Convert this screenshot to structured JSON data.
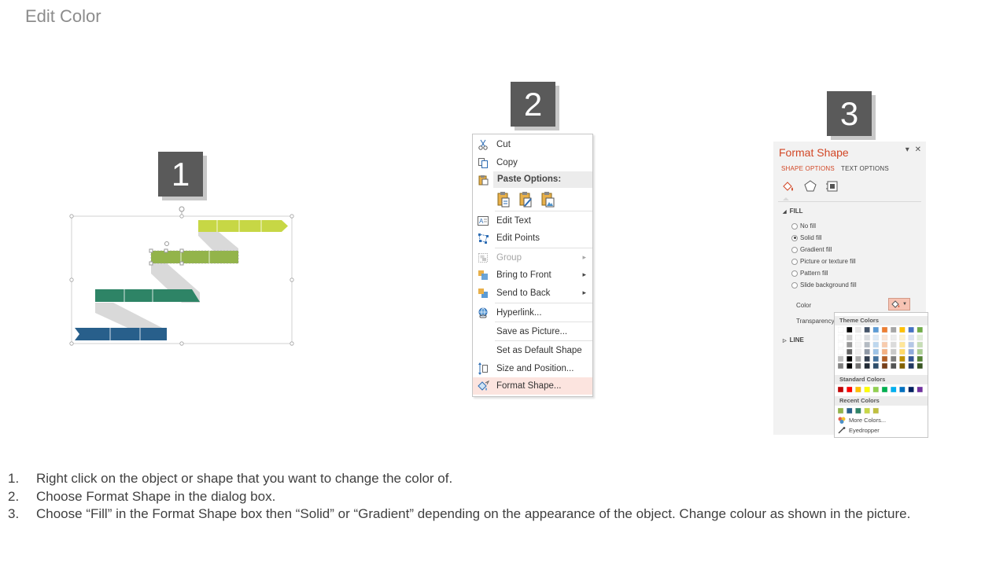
{
  "slide": {
    "title": "Edit Color"
  },
  "steps": {
    "badge1": "1",
    "badge2": "2",
    "badge3": "3"
  },
  "colors": {
    "title_gray": "#8c8c8c",
    "badge_bg": "#5a5a5a",
    "accent_orange": "#d24726",
    "stair_lime": "#c7d745",
    "stair_green": "#93b44a",
    "stair_teal": "#2e8466",
    "stair_blue": "#285f8b"
  },
  "context_menu": {
    "items": [
      {
        "label": "Cut",
        "icon": "scissors-icon"
      },
      {
        "label": "Copy",
        "icon": "copy-icon"
      },
      {
        "label": "Paste Options:",
        "icon": "clipboard-icon"
      },
      {
        "label": "Edit Text",
        "icon": "edit-text-icon"
      },
      {
        "label": "Edit Points",
        "icon": "edit-points-icon"
      },
      {
        "label": "Group",
        "icon": "group-icon",
        "disabled": true
      },
      {
        "label": "Bring to Front",
        "icon": "bring-to-front-icon"
      },
      {
        "label": "Send to Back",
        "icon": "send-to-back-icon"
      },
      {
        "label": "Hyperlink...",
        "icon": "hyperlink-icon"
      },
      {
        "label": "Save as Picture...",
        "icon": ""
      },
      {
        "label": "Set as Default Shape",
        "icon": ""
      },
      {
        "label": "Size and Position...",
        "icon": "size-position-icon"
      },
      {
        "label": "Format Shape...",
        "icon": "format-shape-icon",
        "highlighted": true
      }
    ]
  },
  "format_pane": {
    "title": "Format Shape",
    "tabs": [
      "SHAPE OPTIONS",
      "TEXT OPTIONS"
    ],
    "fill_section": "FILL",
    "fill_options": [
      {
        "label": "No fill",
        "checked": false
      },
      {
        "label": "Solid fill",
        "checked": true
      },
      {
        "label": "Gradient fill",
        "checked": false
      },
      {
        "label": "Picture or texture fill",
        "checked": false
      },
      {
        "label": "Pattern fill",
        "checked": false
      },
      {
        "label": "Slide background fill",
        "checked": false
      }
    ],
    "color_label": "Color",
    "transparency_label": "Transparency",
    "line_section": "LINE"
  },
  "palette": {
    "theme_colors_label": "Theme Colors",
    "standard_colors_label": "Standard Colors",
    "recent_colors_label": "Recent Colors",
    "more_colors": "More Colors...",
    "eyedropper": "Eyedropper",
    "theme_top": [
      "#ffffff",
      "#000000",
      "#e7e6e6",
      "#44546a",
      "#5b9bd5",
      "#ed7d31",
      "#a5a5a5",
      "#ffc000",
      "#4472c4",
      "#70ad47"
    ],
    "standard": [
      "#c00000",
      "#ff0000",
      "#ffc000",
      "#ffff00",
      "#92d050",
      "#00b050",
      "#00b0f0",
      "#0070c0",
      "#002060",
      "#7030a0"
    ],
    "recent": [
      "#93b44a",
      "#285f8b",
      "#2e8466",
      "#c7d745",
      "#bfbf3f"
    ]
  },
  "instructions": [
    {
      "num": "1.",
      "text": "Right click on the object or shape that you want to change the color of."
    },
    {
      "num": "2.",
      "text": "Choose Format Shape in the dialog box."
    },
    {
      "num": "3.",
      "text": "Choose “Fill” in the Format Shape box then “Solid” or “Gradient” depending on the appearance of the object. Change colour as shown in the picture."
    }
  ]
}
